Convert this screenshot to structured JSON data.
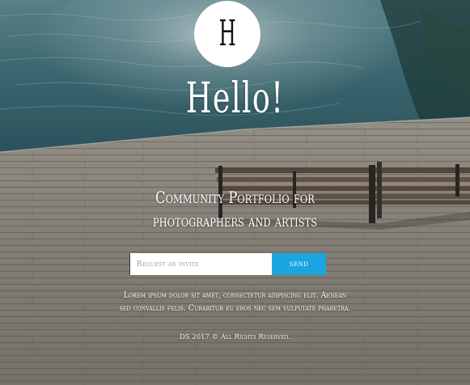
{
  "logo": {
    "letter": "H"
  },
  "hero": {
    "heading": "Hello!",
    "tagline_line1": "Community Portfolio for",
    "tagline_line2": "photographers and artists"
  },
  "invite_form": {
    "placeholder": "Request an invite",
    "send_label": "send"
  },
  "description": "Lorem ipsum dolor sit amet, consectetur adipiscing elit. Aenean sed convallis felis. Curabitur eu eros nec sem vulputate pharetra.",
  "footer": {
    "copyright": "DS 2017 © All Rights Reserved."
  },
  "colors": {
    "accent": "#1aa5e0",
    "text": "#ffffff",
    "water": "#3f6e78",
    "deck": "#8a857c"
  },
  "icons": {
    "logo_mark": "letter-h-logo"
  }
}
